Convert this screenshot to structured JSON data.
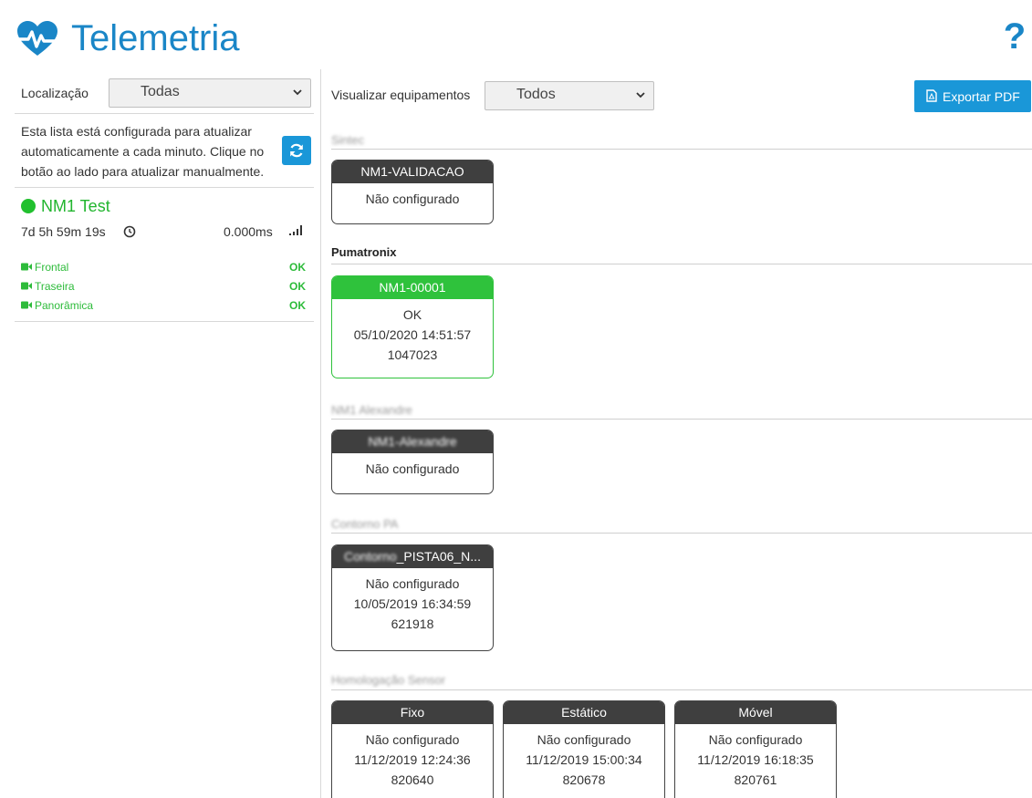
{
  "header": {
    "title": "Telemetria",
    "help": "?",
    "accent_color": "#1a86c7",
    "logo_icon": "heart-pulse-icon"
  },
  "sidebar": {
    "location_label": "Localização",
    "location_value": "Todas",
    "info_text": "Esta lista está configurada para atualizar automaticamente a cada minuto. Clique no botão ao lado para atualizar manualmente.",
    "refresh_icon": "refresh-icon",
    "device": {
      "name": "NM1 Test",
      "status_color": "#21c02e",
      "uptime": "7d 5h 59m 19s",
      "latency": "0.000ms",
      "cameras": [
        {
          "name": "Frontal",
          "status": "OK"
        },
        {
          "name": "Traseira",
          "status": "OK"
        },
        {
          "name": "Panorâmica",
          "status": "OK"
        }
      ]
    }
  },
  "main": {
    "visualize_label": "Visualizar equipamentos",
    "visualize_value": "Todos",
    "export_label": "Exportar PDF",
    "groups": [
      {
        "title": "Sintec",
        "blurred": true,
        "cards": [
          {
            "header": "NM1-VALIDACAO",
            "lines": [
              "Não configurado"
            ],
            "color": "dark"
          }
        ]
      },
      {
        "title": "Pumatronix",
        "blurred": false,
        "cards": [
          {
            "header": "NM1-00001",
            "lines": [
              "OK",
              "05/10/2020 14:51:57",
              "1047023"
            ],
            "color": "green"
          }
        ]
      },
      {
        "title": "NM1 Alexandre",
        "blurred": true,
        "cards": [
          {
            "header": "NM1-Alexandre",
            "header_blurred": true,
            "lines": [
              "Não configurado"
            ],
            "color": "dark"
          }
        ]
      },
      {
        "title": "Contorno PA",
        "blurred": true,
        "cards": [
          {
            "header_blurred_part": "Contorno",
            "header": "_PISTA06_N...",
            "lines": [
              "Não configurado",
              "10/05/2019 16:34:59",
              "621918"
            ],
            "color": "dark"
          }
        ]
      },
      {
        "title": "Homologação Sensor",
        "blurred": true,
        "cards": [
          {
            "header": "Fixo",
            "lines": [
              "Não configurado",
              "11/12/2019 12:24:36",
              "820640"
            ],
            "color": "dark"
          },
          {
            "header": "Estático",
            "lines": [
              "Não configurado",
              "11/12/2019 15:00:34",
              "820678"
            ],
            "color": "dark"
          },
          {
            "header": "Móvel",
            "lines": [
              "Não configurado",
              "11/12/2019 16:18:35",
              "820761"
            ],
            "color": "dark"
          }
        ]
      }
    ]
  }
}
